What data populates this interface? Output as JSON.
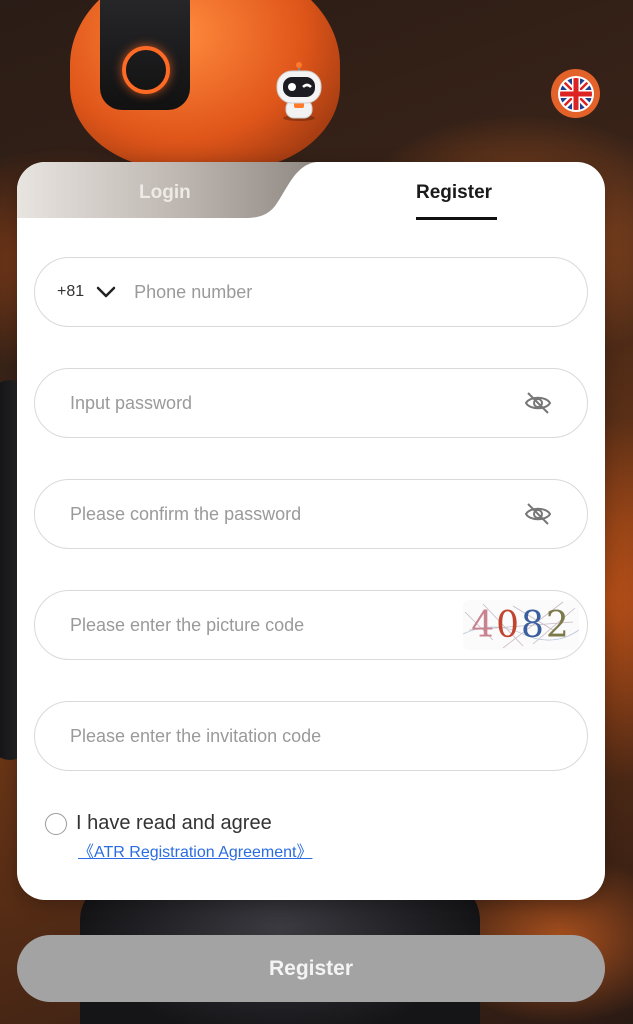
{
  "tabs": {
    "login_label": "Login",
    "register_label": "Register"
  },
  "phone": {
    "country_code": "+81",
    "placeholder": "Phone number"
  },
  "password": {
    "placeholder": "Input password"
  },
  "confirm_password": {
    "placeholder": "Please confirm the password"
  },
  "picture_code": {
    "placeholder": "Please enter the picture code",
    "captcha_digits": [
      "4",
      "0",
      "8",
      "2"
    ]
  },
  "invitation": {
    "placeholder": "Please enter the invitation code"
  },
  "agreement": {
    "text": "I have read and agree",
    "link": "《ATR Registration Agreement》"
  },
  "submit_label": "Register",
  "icons": {
    "avatar": "robot-mascot-icon",
    "language": "uk-flag-icon",
    "dropdown": "chevron-down-icon",
    "password_toggle": "eye-off-icon"
  },
  "colors": {
    "accent_orange": "#e2622a",
    "link_blue": "#2b6de0",
    "submit_disabled": "#a3a3a3",
    "captcha": [
      "#c9838f",
      "#c1442e",
      "#3a5f9e",
      "#7c7a4a"
    ]
  }
}
